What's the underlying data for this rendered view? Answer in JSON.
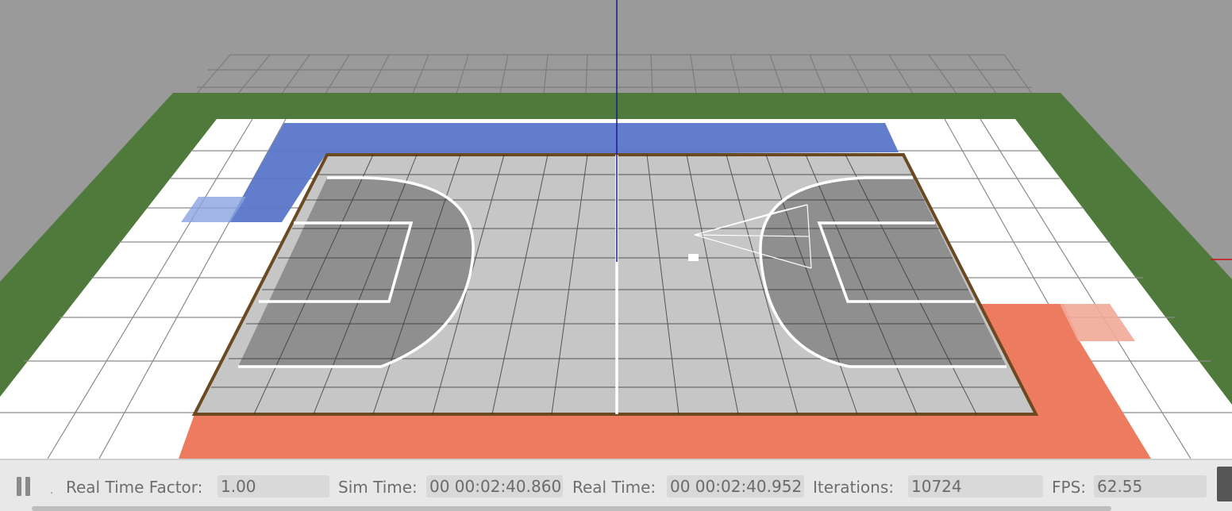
{
  "viewport": {
    "scene": "basketball-court-simulation",
    "colors": {
      "background": "#9a9a9a",
      "grass": "#4f7a3c",
      "floor": "#ffffff",
      "court_light": "#c6c6c6",
      "court_dark": "#8f8f8f",
      "blue_zone": "#5a76c8",
      "red_zone": "#ec7b5f",
      "court_border": "#6b4a22"
    }
  },
  "statusbar": {
    "pause_icon": "pause-icon",
    "real_time_factor_label": "Real Time Factor:",
    "real_time_factor_value": "1.00",
    "sim_time_label": "Sim Time:",
    "sim_time_value": "00 00:02:40.860",
    "real_time_label": "Real Time:",
    "real_time_value": "00 00:02:40.952",
    "iterations_label": "Iterations:",
    "iterations_value": "10724",
    "fps_label": "FPS:",
    "fps_value": "62.55"
  }
}
